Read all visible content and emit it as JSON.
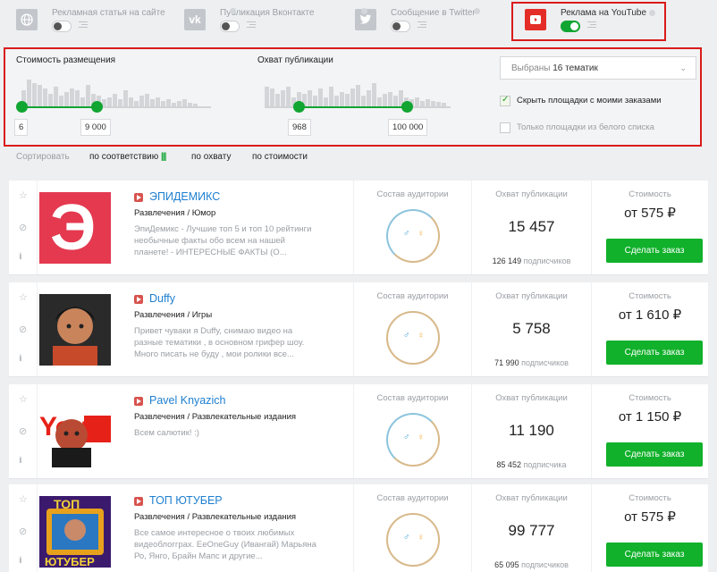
{
  "platforms": [
    {
      "label": "Рекламная статья на сайте",
      "icon": "globe-icon",
      "active": false
    },
    {
      "label": "Публикация Вконтакте",
      "icon": "vk-icon",
      "active": false
    },
    {
      "label": "Сообщение в Twitter",
      "icon": "twitter-icon",
      "active": false
    },
    {
      "label": "Реклама на YouTube",
      "icon": "youtube-icon",
      "active": true
    }
  ],
  "filters": {
    "cost_label": "Стоимость размещения",
    "cost_min": "6",
    "cost_max": "9 000",
    "reach_label": "Охват публикации",
    "reach_min": "968",
    "reach_max": "100 000",
    "topics_prefix": "Выбраны",
    "topics_count": "16 тематик",
    "hide_my_orders": "Скрыть площадки с моими заказами",
    "hide_my_orders_checked": true,
    "whitelist_only": "Только площадки из белого списка",
    "whitelist_only_checked": false
  },
  "sort": {
    "label": "Сортировать",
    "options": [
      "по соответствию",
      "по охвату",
      "по стоимости"
    ],
    "selected": "по соответствию"
  },
  "columns": {
    "audience": "Состав аудитории",
    "reach": "Охват публикации",
    "cost": "Стоимость",
    "order_button": "Сделать заказ",
    "subscribers_word": "подписчиков"
  },
  "channels": [
    {
      "name": "ЭПИДЕМИКС",
      "category": "Развлечения / Юмор",
      "description": "ЭпиДемикс - Лучшие топ 5 и топ 10 рейтинги необычные факты обо всем на нашей планете! - ИНТЕРЕСНЫЕ ФАКТЫ (О...",
      "reach": "15 457",
      "subscribers": "126 149",
      "subscribers_word": "подписчиков",
      "price": "от 575 ₽"
    },
    {
      "name": "Duffy",
      "category": "Развлечения / Игры",
      "description": "Привет чуваки я Duffy, снимаю видео на разные тематики , в основном грифер шоу. Много писать не буду , мои ролики все...",
      "reach": "5 758",
      "subscribers": "71 990",
      "subscribers_word": "подписчиков",
      "price": "от 1 610 ₽"
    },
    {
      "name": "Pavel Knyazich",
      "category": "Развлечения / Развлекательные издания",
      "description": "Всем салютик! :)",
      "reach": "11 190",
      "subscribers": "85 452",
      "subscribers_word": "подписчика",
      "price": "от 1 150 ₽"
    },
    {
      "name": "ТОП ЮТУБЕР",
      "category": "Развлечения / Развлекательные издания",
      "description": "Все самое интересное о твоих любимых видеоблогграх. EeOneGuy (Ивангай) Марьяна Ро, Янго, Брайн Мапс и другие...",
      "reach": "99 777",
      "subscribers": "65 095",
      "subscribers_word": "подписчиков",
      "price": "от 575 ₽"
    }
  ]
}
